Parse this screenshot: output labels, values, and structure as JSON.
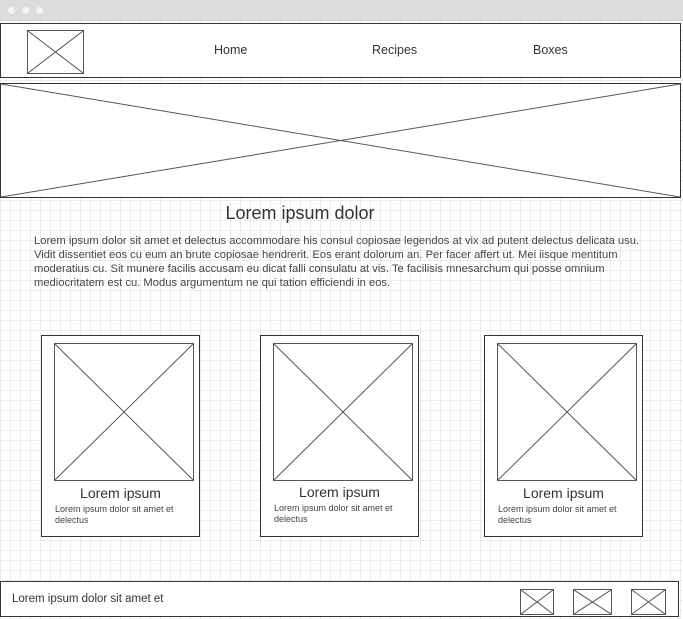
{
  "nav": {
    "logo": "logo-placeholder",
    "items": [
      {
        "label": "Home"
      },
      {
        "label": "Recipes"
      },
      {
        "label": "Boxes"
      }
    ]
  },
  "main": {
    "title": "Lorem ipsum dolor",
    "paragraph": "Lorem ipsum dolor sit amet et delectus accommodare his consul copiosae legendos at vix ad putent delectus delicata usu. Vidit dissentiet eos cu eum an brute copiosae hendrerit. Eos erant dolorum an. Per facer affert ut. Mei iisque mentitum moderatius cu. Sit munere facilis accusam eu dicat falli consulatu at vis. Te facilisis mnesarchum qui posse omnium mediocritatem est cu. Modus argumentum ne qui tation efficiendi in eos."
  },
  "cards": [
    {
      "title": "Lorem ipsum",
      "text": "Lorem ipsum dolor sit amet et delectus"
    },
    {
      "title": "Lorem ipsum",
      "text": "Lorem ipsum dolor sit amet et delectus"
    },
    {
      "title": "Lorem ipsum",
      "text": "Lorem ipsum dolor sit amet et delectus"
    }
  ],
  "footer": {
    "text": "Lorem ipsum dolor sit amet et",
    "icons": [
      "social-icon-placeholder",
      "social-icon-placeholder",
      "social-icon-placeholder"
    ]
  }
}
